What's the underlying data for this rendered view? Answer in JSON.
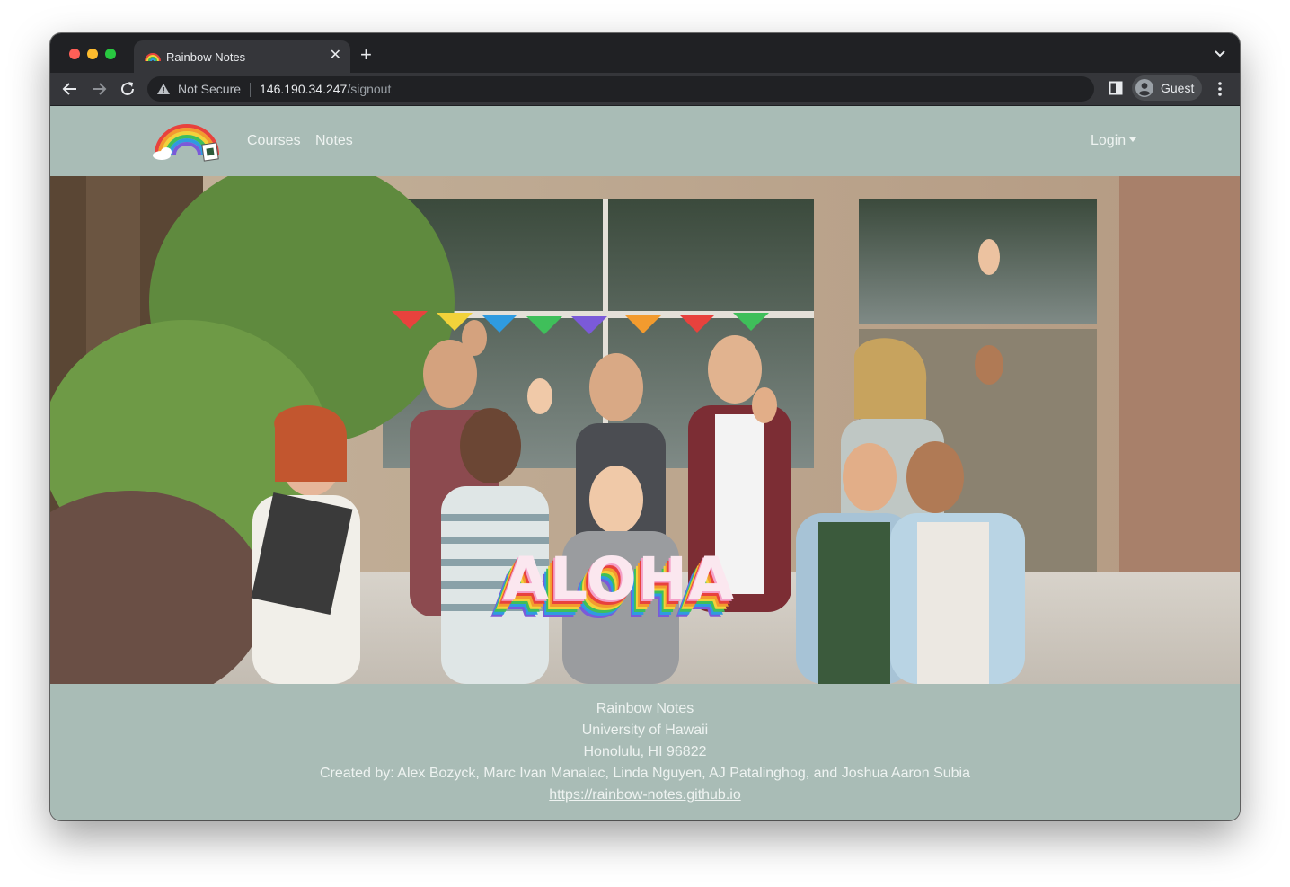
{
  "browser": {
    "tab_title": "Rainbow Notes",
    "new_tab": "+",
    "close_glyph": "✕",
    "address": {
      "security_label": "Not Secure",
      "host": "146.190.34.247",
      "path": "/signout"
    },
    "profile_label": "Guest"
  },
  "navbar": {
    "links": [
      "Courses",
      "Notes"
    ],
    "login_label": "Login"
  },
  "hero": {
    "overlay_text": "ALOHA",
    "rainbow_colors": [
      "#7b5ad9",
      "#2f9be0",
      "#3fbf5a",
      "#f2d23a",
      "#f39b2e",
      "#e8423d",
      "#f4a0c8"
    ]
  },
  "footer": {
    "name": "Rainbow Notes",
    "university": "University of Hawaii",
    "city": "Honolulu, HI 96822",
    "credits": "Created by: Alex Bozyck, Marc Ivan Manalac, Linda Nguyen, AJ Patalinghog, and Joshua Aaron Subia",
    "link": "https://rainbow-notes.github.io"
  },
  "colors": {
    "page_background": "#a9bcb6",
    "nav_text": "#eef3f1",
    "chrome_dark": "#202124",
    "chrome_toolbar": "#35363a"
  }
}
